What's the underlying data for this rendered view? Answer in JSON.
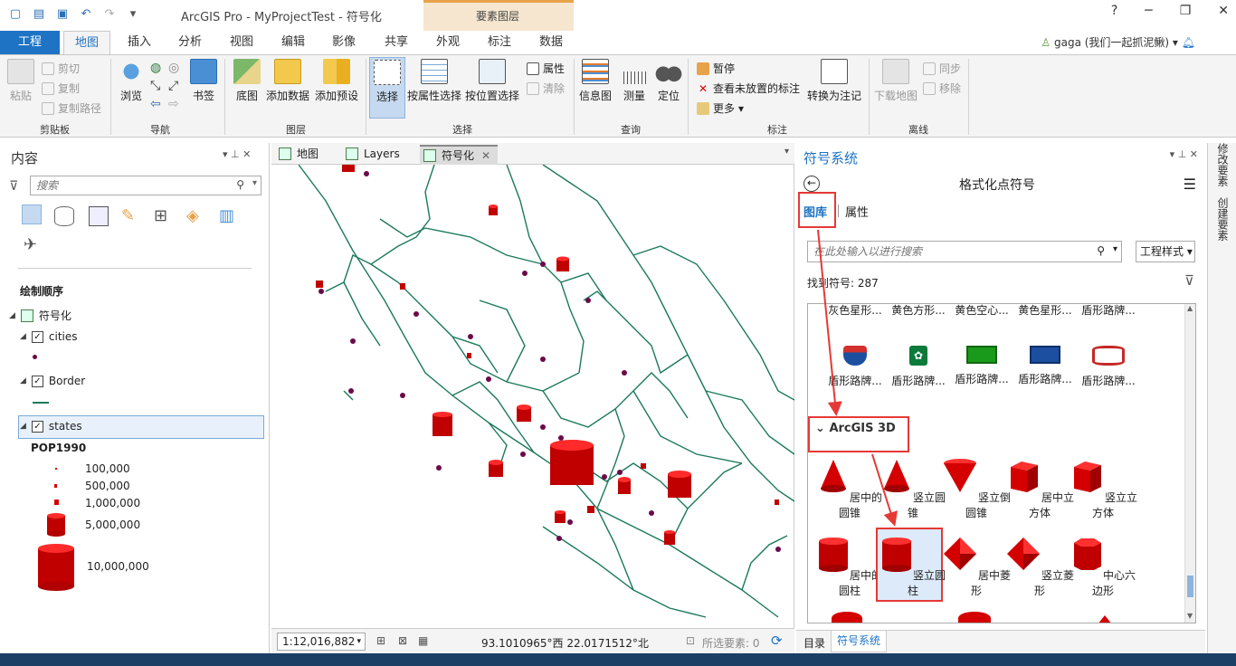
{
  "app": {
    "title": "ArcGIS Pro - MyProjectTest - 符号化",
    "context_group": "要素图层",
    "user": "gaga (我们一起抓泥鳅)",
    "help": "?",
    "minimize": "─",
    "restore": "❐",
    "close": "✕"
  },
  "tabs": [
    "工程",
    "地图",
    "插入",
    "分析",
    "视图",
    "编辑",
    "影像",
    "共享",
    "外观",
    "标注",
    "数据"
  ],
  "ribbon": {
    "clipboard": {
      "paste": "粘贴",
      "cut": "剪切",
      "copy": "复制",
      "copy_path": "复制路径",
      "label": "剪贴板"
    },
    "navigate": {
      "explore": "浏览",
      "bookmarks": "书签",
      "label": "导航"
    },
    "layer": {
      "basemap": "底图",
      "add_data": "添加数据",
      "add_preset": "添加预设",
      "label": "图层"
    },
    "selection": {
      "select": "选择",
      "by_attr": "按属性选择",
      "by_loc": "按位置选择",
      "attributes": "属性",
      "clear": "清除",
      "label": "选择"
    },
    "inquiry": {
      "infographics": "信息图",
      "measure": "测量",
      "locate": "定位",
      "label": "查询"
    },
    "labeling": {
      "pause": "暂停",
      "view_unplaced": "查看未放置的标注",
      "more": "更多",
      "convert": "转换为注记",
      "label": "标注"
    },
    "offline": {
      "download": "下载地图",
      "sync": "同步",
      "remove": "移除",
      "label": "离线"
    }
  },
  "contents": {
    "title": "内容",
    "search_placeholder": "搜索",
    "drawing_order": "绘制顺序",
    "map_name": "符号化",
    "layers": [
      {
        "name": "cities"
      },
      {
        "name": "Border"
      },
      {
        "name": "states"
      }
    ],
    "legend_field": "POP1990",
    "legend": [
      "100,000",
      "500,000",
      "1,000,000",
      "5,000,000",
      "10,000,000"
    ]
  },
  "map": {
    "tabs": [
      "地图",
      "Layers",
      "符号化"
    ],
    "scale": "1:12,016,882",
    "coords": "93.1010965°西 22.0171512°北",
    "selected": "所选要素: 0"
  },
  "symbology": {
    "title": "符号系统",
    "subtitle": "格式化点符号",
    "tab_gallery": "图库",
    "tab_properties": "属性",
    "search_placeholder": "在此处输入以进行搜索",
    "style_dropdown": "工程样式",
    "found": "找到符号: 287",
    "truncated_row": [
      "灰色星形...",
      "黄色方形...",
      "黄色空心...",
      "黄色星形...",
      "盾形路牌..."
    ],
    "shield_row": [
      "盾形路牌...",
      "盾形路牌...",
      "盾形路牌...",
      "盾形路牌...",
      "盾形路牌..."
    ],
    "group_3d": "ArcGIS 3D",
    "row_3d_1": [
      "居中的圆锥",
      "竖立圆锥",
      "竖立倒圆锥",
      "居中立方体",
      "竖立立方体"
    ],
    "row_3d_2": [
      "居中的圆柱",
      "竖立圆柱",
      "居中菱形",
      "竖立菱形",
      "中心六边形"
    ],
    "bottom_tabs": [
      "目录",
      "符号系统"
    ]
  },
  "sidebar": [
    "修改要素",
    "创建要素"
  ],
  "colors": {
    "accent": "#1e73c4",
    "symbol_red": "#d40000",
    "border_green": "#1b7a5a",
    "highlight": "#e53935"
  }
}
